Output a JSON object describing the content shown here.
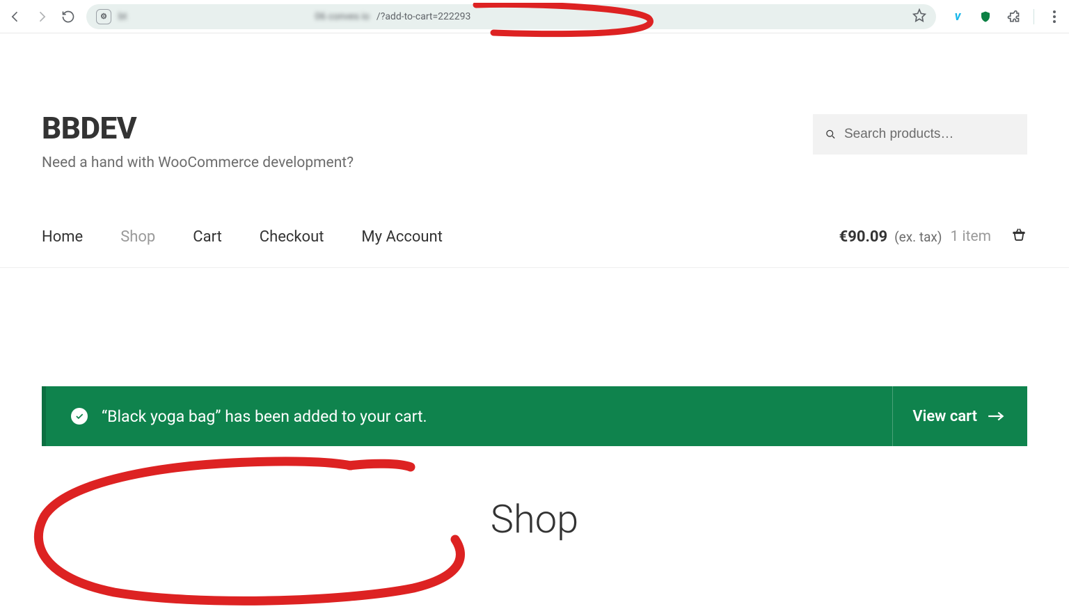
{
  "browser": {
    "url_blurred_prefix": "bt ",
    "url_blurred_host": "06 conves io",
    "url_visible": "/?add-to-cart=222293"
  },
  "site": {
    "title": "BBDEV",
    "tagline": "Need a hand with WooCommerce development?"
  },
  "search": {
    "placeholder": "Search products…"
  },
  "nav": {
    "home": "Home",
    "shop": "Shop",
    "cart": "Cart",
    "checkout": "Checkout",
    "account": "My Account"
  },
  "cart_status": {
    "price": "€90.09",
    "extax": "(ex. tax)",
    "items": "1 item"
  },
  "notice": {
    "text": "“Black yoga bag” has been added to your cart.",
    "button": "View cart"
  },
  "page_title": "Shop"
}
